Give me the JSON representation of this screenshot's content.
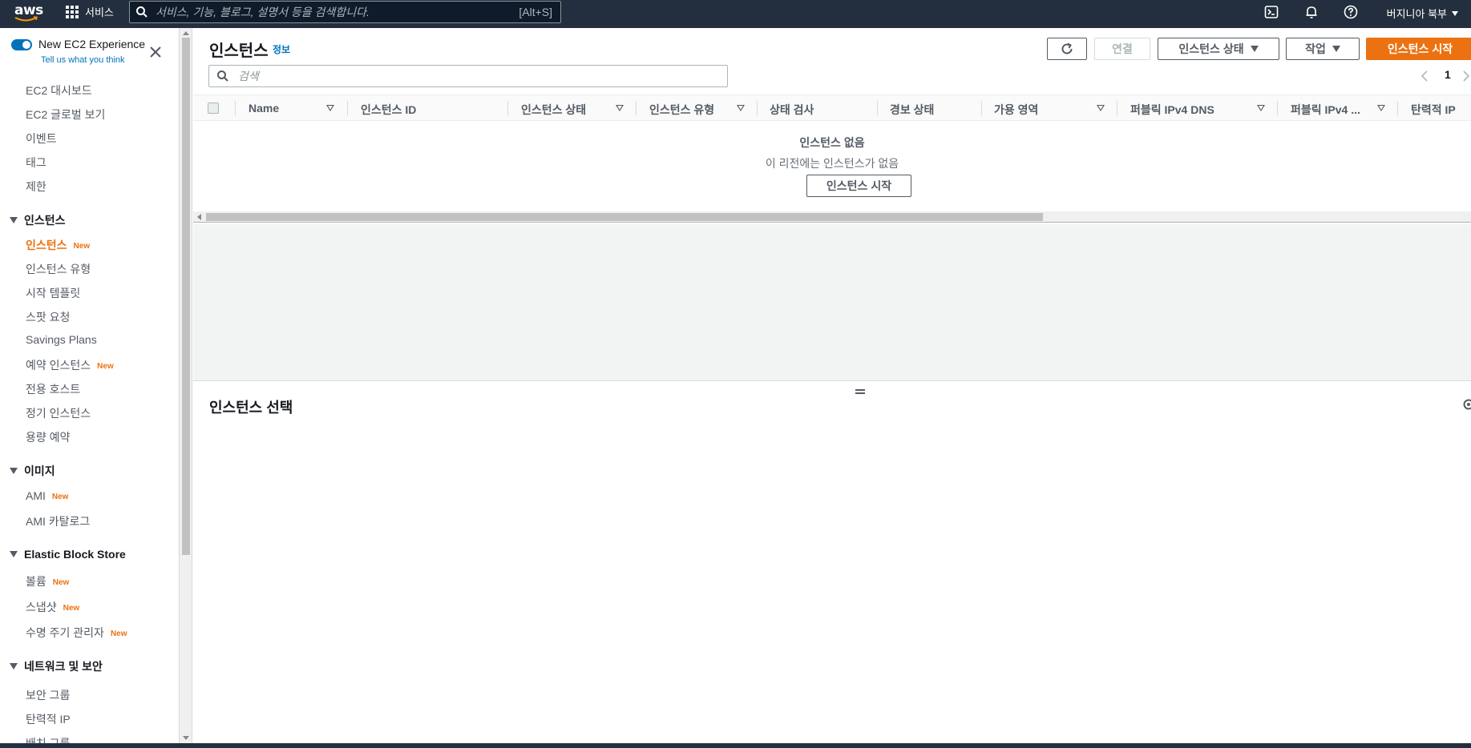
{
  "topnav": {
    "logo": "aws",
    "services_label": "서비스",
    "search_placeholder": "서비스, 기능, 블로그, 설명서 등을 검색합니다.",
    "search_shortcut": "[Alt+S]",
    "region": "버지니아 북부",
    "icons": [
      "cloudshell-icon",
      "bell-icon",
      "help-icon"
    ]
  },
  "sidebar": {
    "experience_label": "New EC2 Experience",
    "feedback_link": "Tell us what you think",
    "top_items": [
      "EC2 대시보드",
      "EC2 글로벌 보기",
      "이벤트",
      "태그",
      "제한"
    ],
    "new_badge": "New",
    "sections": [
      {
        "title": "인스턴스",
        "items": [
          {
            "label": "인스턴스",
            "new": true,
            "active": true
          },
          {
            "label": "인스턴스 유형",
            "new": false
          },
          {
            "label": "시작 템플릿",
            "new": false
          },
          {
            "label": "스팟 요청",
            "new": false
          },
          {
            "label": "Savings Plans",
            "new": false
          },
          {
            "label": "예약 인스턴스",
            "new": true
          },
          {
            "label": "전용 호스트",
            "new": false
          },
          {
            "label": "정기 인스턴스",
            "new": false
          },
          {
            "label": "용량 예약",
            "new": false
          }
        ]
      },
      {
        "title": "이미지",
        "items": [
          {
            "label": "AMI",
            "new": true
          },
          {
            "label": "AMI 카탈로그",
            "new": false
          }
        ]
      },
      {
        "title": "Elastic Block Store",
        "items": [
          {
            "label": "볼륨",
            "new": true
          },
          {
            "label": "스냅샷",
            "new": true
          },
          {
            "label": "수명 주기 관리자",
            "new": true
          }
        ]
      },
      {
        "title": "네트워크 및 보안",
        "items": [
          {
            "label": "보안 그룹",
            "new": false
          },
          {
            "label": "탄력적 IP",
            "new": false
          },
          {
            "label": "배치 그룹",
            "new": false
          }
        ]
      }
    ]
  },
  "main": {
    "title": "인스턴스",
    "info_link": "정보",
    "buttons": {
      "connect": "연결",
      "instance_state": "인스턴스 상태",
      "actions": "작업",
      "launch": "인스턴스 시작"
    },
    "filter_placeholder": "검색",
    "page_number": "1",
    "columns": [
      "Name",
      "인스턴스 ID",
      "인스턴스 상태",
      "인스턴스 유형",
      "상태 검사",
      "경보 상태",
      "가용 영역",
      "퍼블릭 IPv4 DNS",
      "퍼블릭 IPv4 ...",
      "탄력적 IP"
    ],
    "empty_title": "인스턴스 없음",
    "empty_subtitle": "이 리전에는 인스턴스가 없음",
    "empty_button": "인스턴스 시작",
    "detail_title": "인스턴스 선택"
  },
  "colors": {
    "nav_bg": "#232f3e",
    "accent": "#ec7211",
    "link": "#0073bb"
  }
}
